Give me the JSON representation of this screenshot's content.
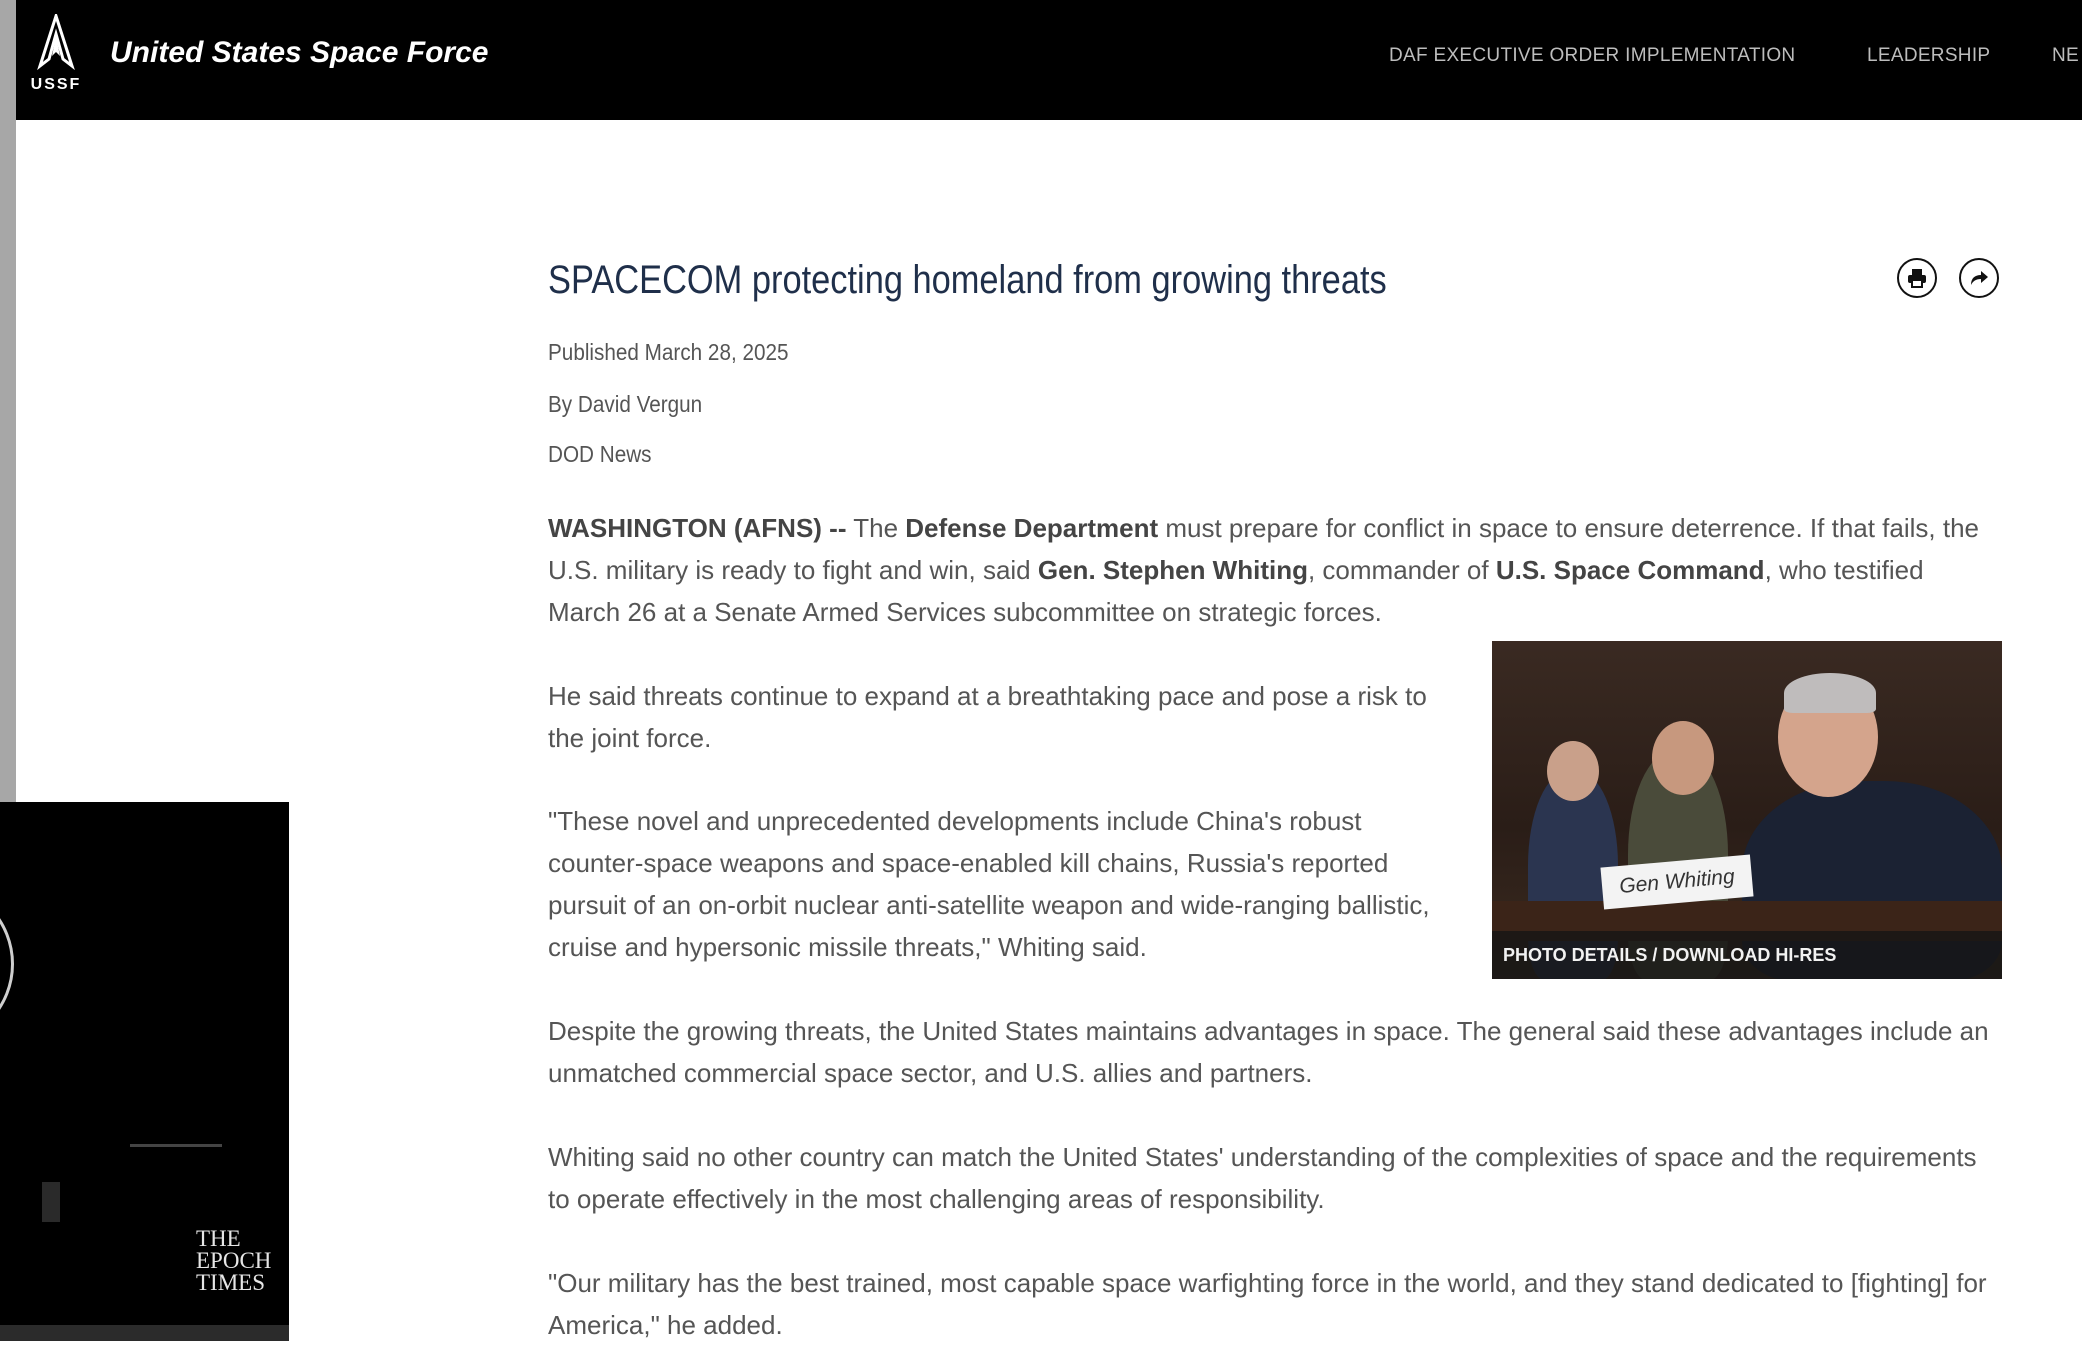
{
  "nav": {
    "logo_text": "USSF",
    "site_title": "United States Space Force",
    "links": [
      "DAF EXECUTIVE ORDER IMPLEMENTATION",
      "LEADERSHIP",
      "NE"
    ]
  },
  "article": {
    "title": "SPACECOM protecting homeland from growing threats",
    "published": "Published March 28, 2025",
    "byline": "By David Vergun",
    "source": "DOD News",
    "actions": {
      "print_icon": "print-icon",
      "share_icon": "share-icon"
    },
    "p1": {
      "dateline": "WASHINGTON (AFNS) --",
      "t1": " The ",
      "b1": "Defense Department",
      "t2": " must prepare for conflict in space to ensure deterrence. If that fails, the U.S. military is ready to fight and win, said ",
      "b2": "Gen. Stephen Whiting",
      "t3": ", commander of ",
      "b3": "U.S. Space Command",
      "t4": ", who testified March 26 at a Senate Armed Services subcommittee on strategic forces."
    },
    "p2": "He said threats continue to expand at a breathtaking pace and pose a risk to the joint force.",
    "p3": "\"These novel and unprecedented developments include China's robust counter-space weapons and space-enabled kill chains, Russia's reported pursuit of an on-orbit nuclear anti-satellite weapon and wide-ranging ballistic, cruise and hypersonic missile threats,\" Whiting said.",
    "p4": "Despite the growing threats, the United States maintains advantages in space. The general said these advantages include an unmatched commercial space sector, and U.S. allies and partners.",
    "p5": "Whiting said no other country can match the United States' understanding of the complexities of space and the requirements to operate effectively in the most challenging areas of responsibility.",
    "p6": "\"Our military has the best trained, most capable space warfighting force in the world, and they stand dedicated to [fighting] for America,\" he added.",
    "photo": {
      "nameplate": "Gen Whiting",
      "caption": "PHOTO DETAILS / DOWNLOAD HI-RES"
    }
  },
  "overlay": {
    "brand": "THE\nEPOCH\nTIMES"
  }
}
